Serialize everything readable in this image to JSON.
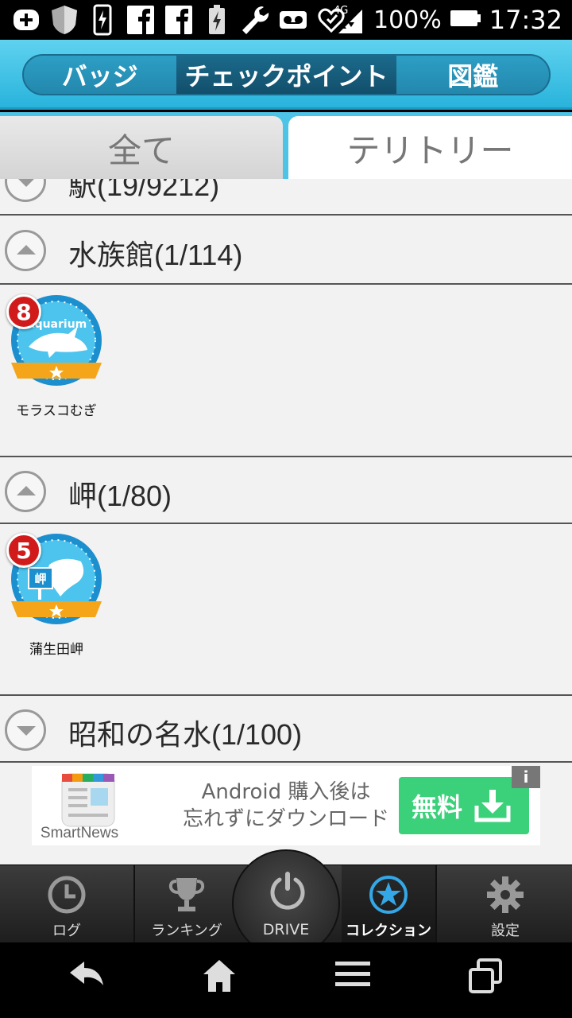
{
  "status_bar": {
    "icons": [
      "plus-notification-icon",
      "shield-icon",
      "phone-charge-icon",
      "facebook-icon",
      "facebook-icon-2",
      "battery-charge-icon",
      "wrench-icon",
      "voicemail-icon",
      "heart-icon",
      "signal-4g-icon",
      "battery-icon"
    ],
    "network": "4G",
    "battery_percent": "100%",
    "time": "17:32"
  },
  "header": {
    "tabs": [
      {
        "label": "バッジ"
      },
      {
        "label": "チェックポイント",
        "active": true
      },
      {
        "label": "図鑑"
      }
    ]
  },
  "filter_tabs": [
    {
      "label": "全て"
    },
    {
      "label": "テリトリー",
      "active": true
    }
  ],
  "categories": [
    {
      "label": "駅(19/9212)",
      "expanded": false
    },
    {
      "label": "水族館(1/114)",
      "expanded": true,
      "items": [
        {
          "name": "モラスコむぎ",
          "count": "8",
          "icon": "aquarium-badge-icon",
          "badge_text": "Aquarium"
        }
      ]
    },
    {
      "label": "岬(1/80)",
      "expanded": true,
      "items": [
        {
          "name": "蒲生田岬",
          "count": "5",
          "icon": "cape-badge-icon",
          "badge_text": "岬"
        }
      ]
    },
    {
      "label": "昭和の名水(1/100)",
      "expanded": false
    }
  ],
  "ad": {
    "brand": "SmartNews",
    "line1": "Android 購入後は",
    "line2": "忘れずにダウンロード",
    "button": "無料",
    "info": "i"
  },
  "bottom_nav": {
    "items": [
      {
        "label": "ログ",
        "icon": "clock-icon"
      },
      {
        "label": "ランキング",
        "icon": "trophy-icon"
      },
      {
        "label": "DRIVE",
        "icon": "power-icon"
      },
      {
        "label": "コレクション",
        "icon": "star-icon",
        "active": true
      },
      {
        "label": "設定",
        "icon": "gear-icon"
      }
    ]
  },
  "system_nav": {
    "icons": [
      "back-icon",
      "home-icon",
      "menu-icon",
      "recents-icon"
    ]
  },
  "colors": {
    "header_blue": "#29b3dc",
    "badge_red": "#d11b1b",
    "ad_green": "#3bd07a"
  }
}
